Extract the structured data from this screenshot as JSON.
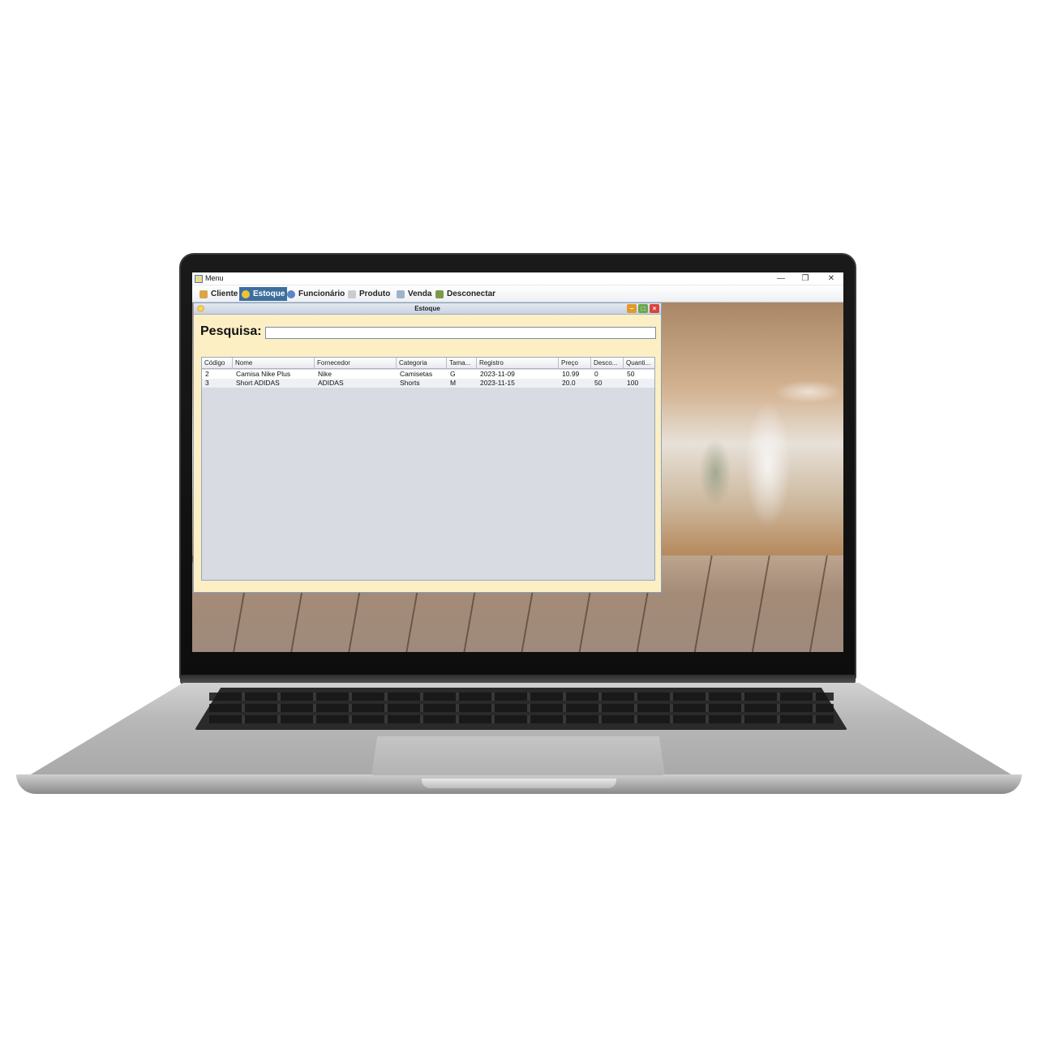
{
  "window": {
    "title": "Menu",
    "controls": {
      "minimize": "—",
      "restore": "❐",
      "close": "✕"
    }
  },
  "menubar": {
    "items": [
      {
        "label": "Cliente",
        "icon": "client-icon",
        "active": false
      },
      {
        "label": "Estoque",
        "icon": "stock-icon",
        "active": true
      },
      {
        "label": "Funcionário",
        "icon": "employee-icon",
        "active": false
      },
      {
        "label": "Produto",
        "icon": "product-icon",
        "active": false
      },
      {
        "label": "Venda",
        "icon": "sale-icon",
        "active": false
      },
      {
        "label": "Desconectar",
        "icon": "disconnect-icon",
        "active": false
      }
    ]
  },
  "estoque": {
    "title": "Estoque",
    "search_label": "Pesquisa:",
    "search_value": "",
    "columns": [
      "Código",
      "Nome",
      "Fornecedor",
      "Categoria",
      "Tama...",
      "Registro",
      "Preço",
      "Desco...",
      "Quanti..."
    ],
    "rows": [
      [
        "2",
        "Camisa Nike Plus",
        "Nike",
        "Camisetas",
        "G",
        "2023-11-09",
        "10.99",
        "0",
        "50"
      ],
      [
        "3",
        "Short ADIDAS",
        "ADIDAS",
        "Shorts",
        "M",
        "2023-11-15",
        "20.0",
        "50",
        "100"
      ]
    ]
  },
  "colors": {
    "frame_bg": "#fcefc4",
    "active_menu": "#3d6f9e",
    "table_bg": "#d8dbe2"
  }
}
